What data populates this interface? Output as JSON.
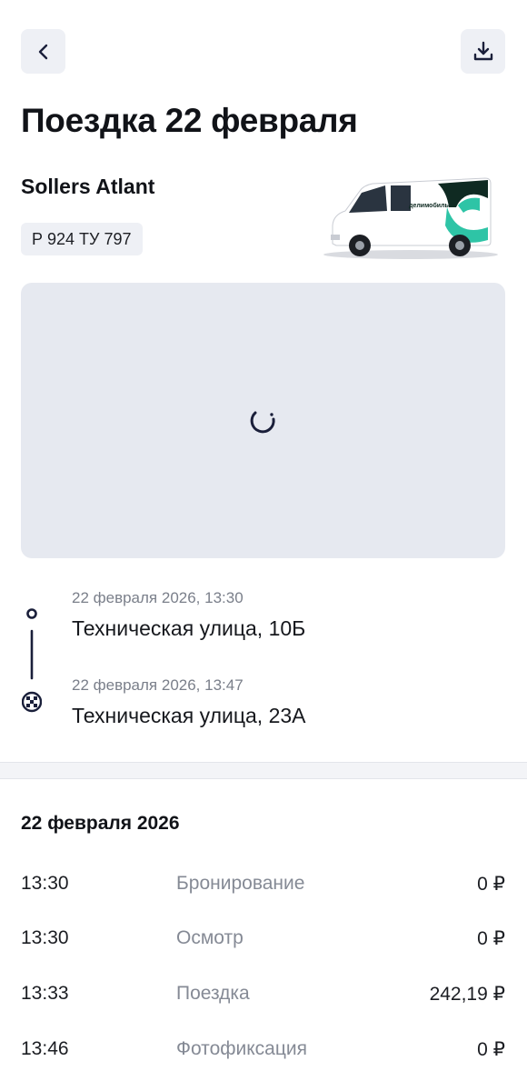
{
  "header": {
    "back_icon": "chevron-left-icon",
    "download_icon": "download-icon",
    "title": "Поездка 22 февраля"
  },
  "vehicle": {
    "model": "Sollers Atlant",
    "plate": "Р 924 ТУ 797",
    "image_icon": "van-illustration",
    "brand_text": "делимобиль"
  },
  "map": {
    "state": "loading",
    "spinner_icon": "loading-spinner-icon"
  },
  "route": {
    "start": {
      "time": "22 февраля 2026, 13:30",
      "address": "Техническая улица, 10Б"
    },
    "end": {
      "time": "22 февраля 2026, 13:47",
      "address": "Техническая улица, 23А"
    }
  },
  "history": {
    "date": "22 февраля 2026",
    "rows": [
      {
        "time": "13:30",
        "event": "Бронирование",
        "price": "0 ₽"
      },
      {
        "time": "13:30",
        "event": "Осмотр",
        "price": "0 ₽"
      },
      {
        "time": "13:33",
        "event": "Поездка",
        "price": "242,19 ₽"
      },
      {
        "time": "13:46",
        "event": "Фотофиксация",
        "price": "0 ₽"
      }
    ]
  },
  "colors": {
    "accent_teal": "#2ec4a6",
    "dark_green": "#0f2a22",
    "surface": "#eef0f5",
    "map_bg": "#e6e9f0",
    "route_line": "#1a1f3a"
  }
}
